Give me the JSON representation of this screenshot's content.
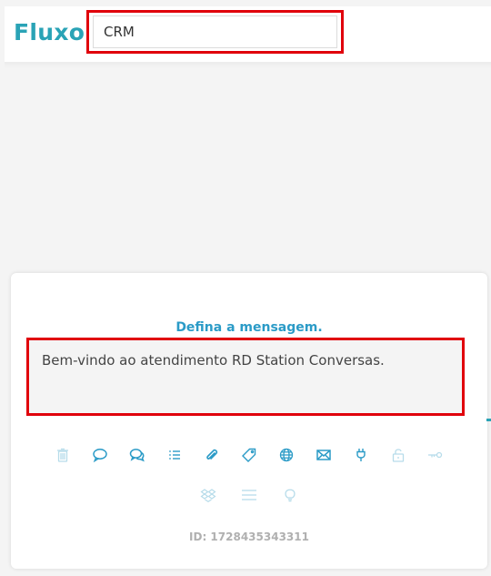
{
  "header": {
    "brand": "Fluxo",
    "flow_name": "CRM"
  },
  "card": {
    "title": "Defina a mensagem.",
    "message": "Bem-vindo ao atendimento RD Station Conversas.",
    "id_label": "ID: 1728435343311",
    "icons_row1": [
      "trash-icon",
      "speech-bubble-icon",
      "speech-bubbles-icon",
      "list-icon",
      "paperclip-icon",
      "tag-icon",
      "globe-icon",
      "envelope-icon",
      "plug-icon",
      "unlock-icon",
      "key-icon"
    ],
    "icons_row2": [
      "dropbox-icon",
      "menu-lines-icon",
      "lightbulb-icon"
    ]
  },
  "colors": {
    "brand": "#2aa3b6",
    "title": "#2b9bc7",
    "highlight": "#e0000b",
    "icon_active": "#2b9bc7",
    "icon_muted": "#b7dcea"
  }
}
